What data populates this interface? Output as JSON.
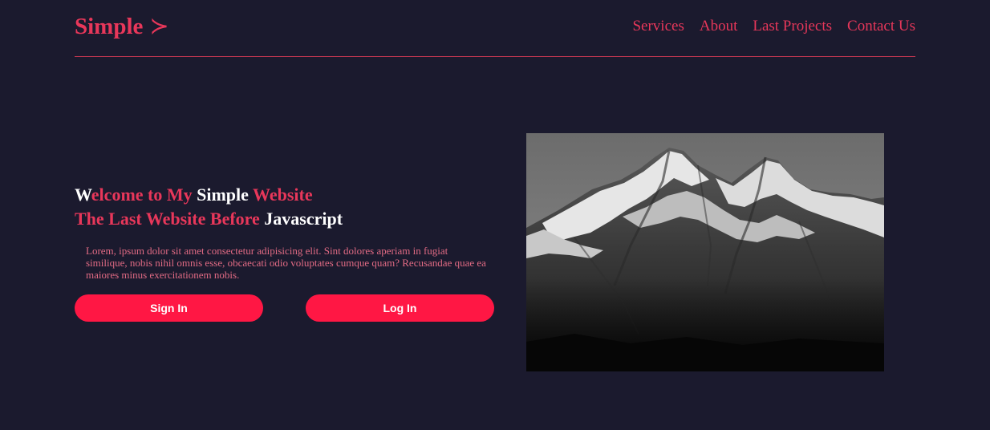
{
  "brand": {
    "name": "Simple",
    "arrow": "≻"
  },
  "nav": {
    "items": [
      {
        "label": "Services"
      },
      {
        "label": "About"
      },
      {
        "label": "Last Projects"
      },
      {
        "label": "Contact Us"
      }
    ]
  },
  "hero": {
    "line1": {
      "w_letter": "W",
      "elcome_to_my": "elcome to My",
      "simple": "Simple",
      "website": "Website"
    },
    "line2": {
      "the_last_website_before": "The Last Website Before",
      "javascript": "Javascript"
    },
    "paragraph": "Lorem, ipsum dolor sit amet consectetur adipisicing elit. Sint dolores aperiam in fugiat similique, nobis nihil omnis esse, obcaecati odio voluptates cumque quam? Recusandae quae ea maiores minus exercitationem nobis."
  },
  "buttons": {
    "sign_in": "Sign In",
    "log_in": "Log In"
  },
  "colors": {
    "background": "#1b1a2e",
    "accent": "#e8375a",
    "button": "#ff1744",
    "divider": "#c23651"
  }
}
